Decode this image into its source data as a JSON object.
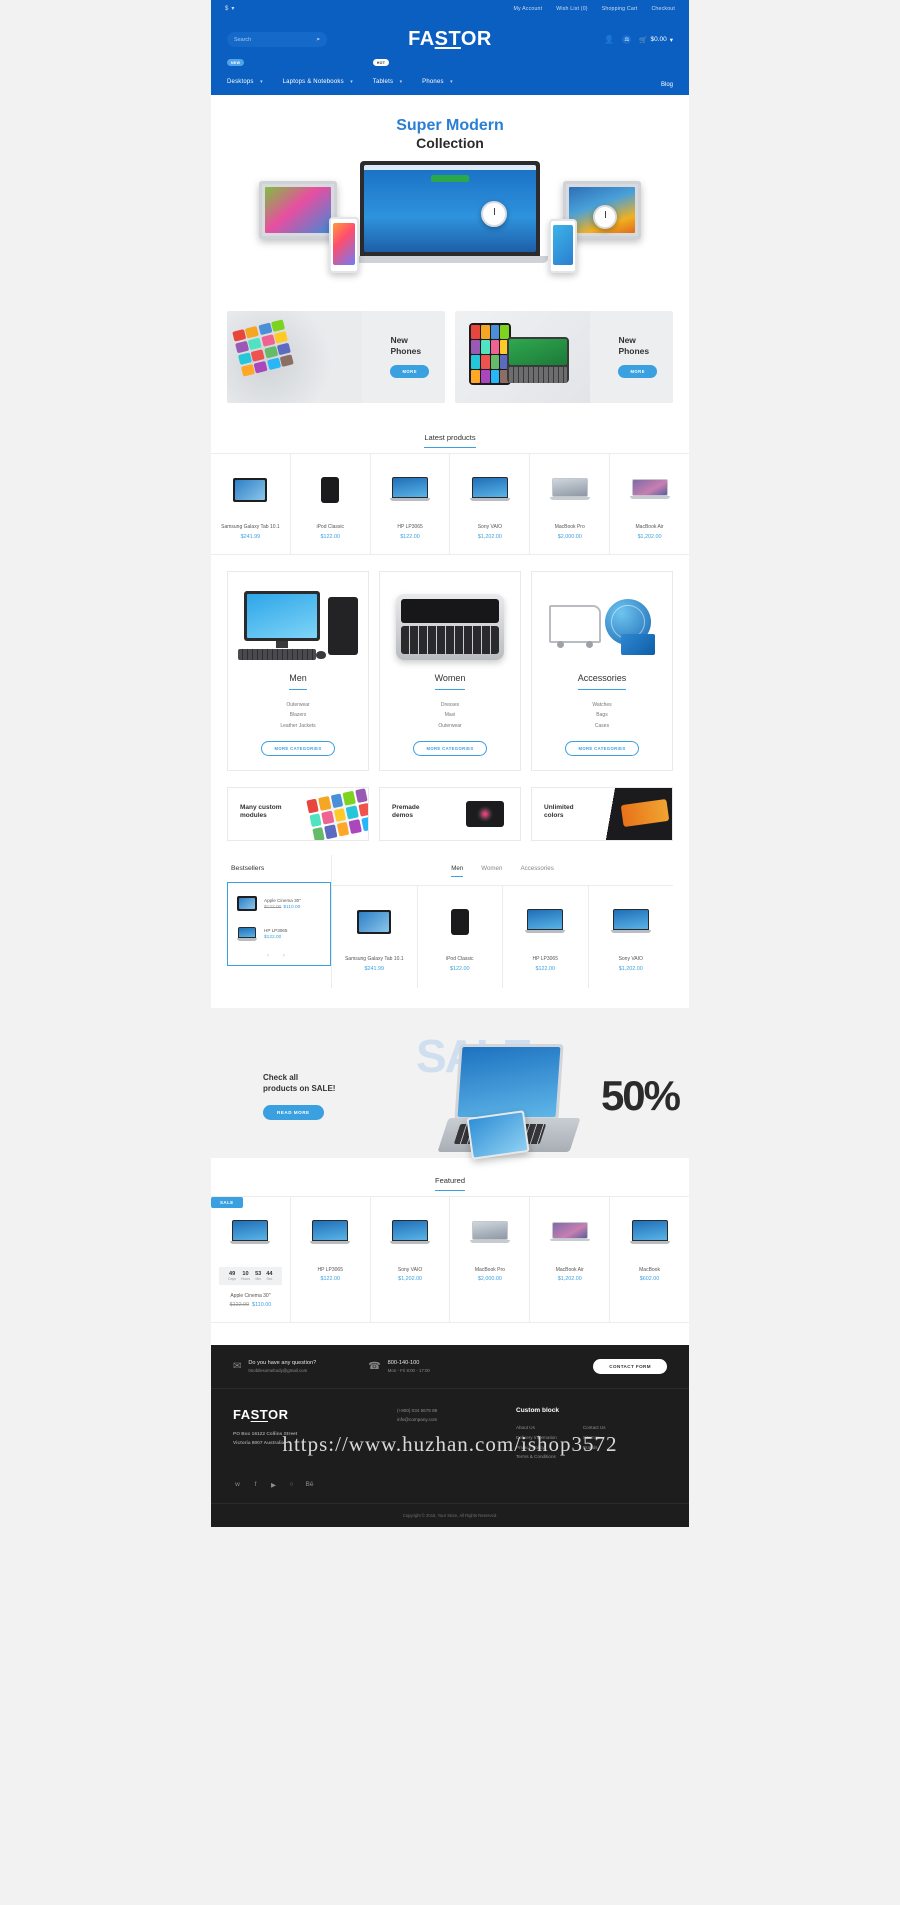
{
  "header": {
    "currency": "$",
    "top_links": [
      "My Account",
      "Wish List (0)",
      "Shopping Cart",
      "Checkout"
    ],
    "search_placeholder": "Search",
    "logo": {
      "pre": "FA",
      "mid": "ST",
      "post": "OR"
    },
    "cart_total": "$0.00",
    "nav": [
      {
        "label": "Desktops",
        "badge": "NEW",
        "badge_type": "new"
      },
      {
        "label": "Laptops & Notebooks",
        "badge": "",
        "badge_type": ""
      },
      {
        "label": "Tablets",
        "badge": "HOT",
        "badge_type": "hot"
      },
      {
        "label": "Phones",
        "badge": "",
        "badge_type": ""
      }
    ],
    "nav_right": "Blog"
  },
  "hero": {
    "title_top": "Super Modern",
    "title_bottom": "Collection"
  },
  "banners": [
    {
      "title_l1": "New",
      "title_l2": "Phones",
      "button": "MORE"
    },
    {
      "title_l1": "New",
      "title_l2": "Phones",
      "button": "MORE"
    }
  ],
  "latest": {
    "title": "Latest products",
    "products": [
      {
        "name": "Samsung Galaxy Tab 10.1",
        "price": "$241.99",
        "old": "",
        "art": "tab"
      },
      {
        "name": "iPod Classic",
        "price": "$122.00",
        "old": "",
        "art": "pod"
      },
      {
        "name": "HP LP3065",
        "price": "$122.00",
        "old": "",
        "art": "laptop"
      },
      {
        "name": "Sony VAIO",
        "price": "$1,202.00",
        "old": "",
        "art": "laptop"
      },
      {
        "name": "MacBook Pro",
        "price": "$2,000.00",
        "old": "",
        "art": "mbp"
      },
      {
        "name": "MacBook Air",
        "price": "$1,202.00",
        "old": "",
        "art": "mba"
      }
    ]
  },
  "categories": [
    {
      "title": "Men",
      "items": [
        "Outerwear",
        "Blazers",
        "Leather Jackets"
      ],
      "button": "MORE CATEGORIES",
      "art": "pc"
    },
    {
      "title": "Women",
      "items": [
        "Dresses",
        "Maxi",
        "Outerwear"
      ],
      "button": "MORE CATEGORIES",
      "art": "bb"
    },
    {
      "title": "Accessories",
      "items": [
        "Watches",
        "Bags",
        "Cases"
      ],
      "button": "MORE CATEGORIES",
      "art": "acc"
    }
  ],
  "feature_tiles": [
    {
      "l1": "Many custom",
      "l2": "modules",
      "art": "modules"
    },
    {
      "l1": "Premade",
      "l2": "demos",
      "art": "camera"
    },
    {
      "l1": "Unlimited",
      "l2": "colors",
      "art": "colors"
    }
  ],
  "bestsellers": {
    "title": "Bestsellers",
    "items": [
      {
        "name": "Apple Cinema 30\"",
        "price": "$110.00",
        "old": "$122.00",
        "art": "mbp"
      },
      {
        "name": "HP LP3065",
        "price": "$122.00",
        "old": "",
        "art": "laptop"
      }
    ],
    "tabs": [
      "Men",
      "Women",
      "Accessories"
    ],
    "active_tab": "Men",
    "products": [
      {
        "name": "Samsung Galaxy Tab 10.1",
        "price": "$241.99",
        "old": "",
        "art": "tab"
      },
      {
        "name": "iPod Classic",
        "price": "$122.00",
        "old": "",
        "art": "pod"
      },
      {
        "name": "HP LP3065",
        "price": "$122.00",
        "old": "",
        "art": "laptop"
      },
      {
        "name": "Sony VAIO",
        "price": "$1,202.00",
        "old": "",
        "art": "laptop"
      }
    ]
  },
  "sale": {
    "line1": "Check all",
    "line2": "products on SALE!",
    "button": "READ MORE",
    "word": "SALE",
    "percent": "50%"
  },
  "featured": {
    "title": "Featured",
    "sale_tag": "SALE",
    "countdown": [
      {
        "value": "49",
        "unit": "Days"
      },
      {
        "value": "10",
        "unit": "Hours"
      },
      {
        "value": "53",
        "unit": "Min"
      },
      {
        "value": "44",
        "unit": "Sec"
      }
    ],
    "products": [
      {
        "name": "Apple Cinema 30\"",
        "price": "$110.00",
        "old": "$122.00",
        "art": "laptop"
      },
      {
        "name": "HP LP3065",
        "price": "$122.00",
        "old": "",
        "art": "laptop"
      },
      {
        "name": "Sony VAIO",
        "price": "$1,202.00",
        "old": "",
        "art": "laptop"
      },
      {
        "name": "MacBook Pro",
        "price": "$2,000.00",
        "old": "",
        "art": "mbp"
      },
      {
        "name": "MacBook Air",
        "price": "$1,202.00",
        "old": "",
        "art": "mba"
      },
      {
        "name": "MacBook",
        "price": "$602.00",
        "old": "",
        "art": "laptop"
      }
    ]
  },
  "footer": {
    "question": "Do you have any question?",
    "email": "tmobilesomebody@gmail.com",
    "phone": "800-140-100",
    "hours": "Mon - Fri 8:00 - 17:00",
    "contact_button": "CONTACT FORM",
    "logo": {
      "pre": "FA",
      "mid": "ST",
      "post": "OR"
    },
    "address_l1": "PO Box 16122 Collins Street",
    "address_l2": "Victoria 8007 Australia",
    "contact_phone": "(+800) 034 5678 88",
    "contact_email": "info@company.com",
    "custom_block_title": "Custom block",
    "links_col1": [
      "About Us",
      "Delivery Information",
      "Privacy Policy",
      "Terms & Conditions"
    ],
    "links_col2": [
      "Contact Us",
      "Sitemap",
      "Brands"
    ],
    "social": [
      "twitter",
      "facebook",
      "youtube",
      "github",
      "behance"
    ],
    "copyright": "Copyright © 2016, Your Store, All Rights Reserved."
  },
  "watermark": "https://www.huzhan.com/ishop3572"
}
